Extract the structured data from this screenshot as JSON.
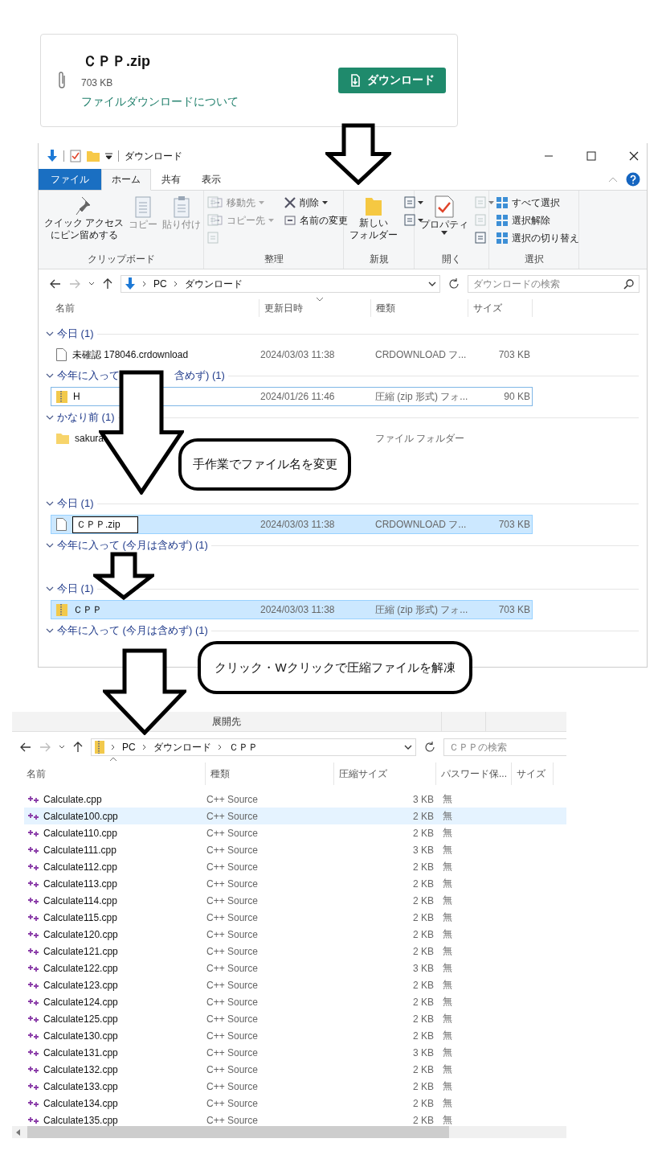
{
  "download_card": {
    "file_name": "ＣＰＰ.zip",
    "size": "703 KB",
    "link": "ファイルダウンロードについて",
    "button": "ダウンロード"
  },
  "explorer": {
    "title": "ダウンロード",
    "tabs": [
      {
        "label": "ファイル",
        "kind": "file",
        "selected": false
      },
      {
        "label": "ホーム",
        "kind": "tab",
        "selected": true
      },
      {
        "label": "共有",
        "kind": "tab",
        "selected": false
      },
      {
        "label": "表示",
        "kind": "tab",
        "selected": false
      }
    ],
    "ribbon": [
      {
        "label": "クリップボード",
        "items": [
          {
            "kind": "large",
            "lines": [
              "クイック アクセス",
              "にピン留めする"
            ],
            "disabled": false,
            "dropdown": false
          },
          {
            "kind": "large",
            "lines": [
              "コピー"
            ],
            "disabled": true,
            "dropdown": false
          },
          {
            "kind": "large",
            "lines": [
              "貼り付け"
            ],
            "disabled": true,
            "dropdown": false
          },
          {
            "kind": "icon",
            "disabled": true,
            "dropdown": false
          },
          {
            "kind": "icon",
            "disabled": true,
            "dropdown": false
          },
          {
            "kind": "icon",
            "disabled": true,
            "dropdown": false
          }
        ]
      },
      {
        "label": "整理",
        "items": [
          {
            "kind": "small",
            "label": "移動先",
            "disabled": true,
            "dropdown": true
          },
          {
            "kind": "small",
            "label": "コピー先",
            "disabled": true,
            "dropdown": true
          },
          {
            "kind": "small",
            "label": "削除",
            "disabled": false,
            "dropdown": true
          },
          {
            "kind": "small",
            "label": "名前の変更",
            "disabled": false,
            "dropdown": false
          }
        ]
      },
      {
        "label": "新規",
        "items": [
          {
            "kind": "large",
            "lines": [
              "新しい",
              "フォルダー"
            ],
            "disabled": false,
            "dropdown": false
          },
          {
            "kind": "icon",
            "disabled": false,
            "dropdown": true
          },
          {
            "kind": "icon",
            "disabled": false,
            "dropdown": true
          }
        ]
      },
      {
        "label": "開く",
        "items": [
          {
            "kind": "large",
            "lines": [
              "プロパティ"
            ],
            "disabled": false,
            "dropdown": true
          },
          {
            "kind": "icon",
            "disabled": true,
            "dropdown": true
          },
          {
            "kind": "icon",
            "disabled": true,
            "dropdown": false
          },
          {
            "kind": "icon",
            "disabled": false,
            "dropdown": false
          }
        ]
      },
      {
        "label": "選択",
        "items": [
          {
            "kind": "small",
            "label": "すべて選択",
            "disabled": false,
            "dropdown": false
          },
          {
            "kind": "small",
            "label": "選択解除",
            "disabled": false,
            "dropdown": false
          },
          {
            "kind": "small",
            "label": "選択の切り替え",
            "disabled": false,
            "dropdown": false
          }
        ]
      }
    ],
    "breadcrumbs": [
      "PC",
      "ダウンロード"
    ],
    "search_placeholder": "ダウンロードの検索",
    "columns": [
      "名前",
      "更新日時",
      "種類",
      "サイズ"
    ],
    "views": [
      {
        "groups": [
          {
            "label": "今日 (1)",
            "rows": [
              {
                "kind": "file",
                "name": "未確認 178046.crdownload",
                "date": "2024/03/03 11:38",
                "type": "CRDOWNLOAD フ...",
                "size": "703 KB",
                "selected": false,
                "focused": false,
                "editing": false
              }
            ]
          },
          {
            "label": "今年に入って",
            "label_after_gap": "含めず) (1)",
            "rows": [
              {
                "kind": "zip",
                "name": "H",
                "date": "2024/01/26 11:46",
                "type": "圧縮 (zip 形式) フォ...",
                "size": "90 KB",
                "selected": false,
                "focused": true,
                "editing": false
              }
            ]
          },
          {
            "label": "かなり前 (1)",
            "rows": [
              {
                "kind": "folder",
                "name": "sakura",
                "type": "ファイル フォルダー",
                "selected": false,
                "focused": false,
                "editing": false
              }
            ]
          }
        ]
      },
      {
        "groups": [
          {
            "label": "今日 (1)",
            "rows": [
              {
                "kind": "file",
                "name": "ＣＰＰ.zip",
                "date": "2024/03/03 11:38",
                "type": "CRDOWNLOAD フ...",
                "size": "703 KB",
                "selected": true,
                "focused": false,
                "editing": true
              }
            ]
          },
          {
            "label": "今年に入って (今月は含めず) (1)"
          }
        ]
      },
      {
        "groups": [
          {
            "label": "今日 (1)",
            "rows": [
              {
                "kind": "zip",
                "name": "ＣＰＰ",
                "date": "2024/03/03 11:38",
                "type": "圧縮 (zip 形式) フォ...",
                "size": "703 KB",
                "selected": true,
                "focused": false,
                "editing": false
              }
            ]
          },
          {
            "label": "今年に入って (今月は含めず) (1)"
          }
        ]
      }
    ]
  },
  "callouts": [
    "手作業でファイル名を変更",
    "クリック・Wクリックで圧縮ファイルを解凍"
  ],
  "extract_window": {
    "header": "展開先",
    "breadcrumbs": [
      "PC",
      "ダウンロード",
      "ＣＰＰ"
    ],
    "search_placeholder": "ＣＰＰの検索",
    "columns": [
      "名前",
      "種類",
      "圧縮サイズ",
      "パスワード保...",
      "サイズ"
    ],
    "rows": [
      {
        "name": "Calculate.cpp",
        "type": "C++ Source",
        "compressed": "3 KB",
        "password": "無",
        "selected": false
      },
      {
        "name": "Calculate100.cpp",
        "type": "C++ Source",
        "compressed": "2 KB",
        "password": "無",
        "selected": true
      },
      {
        "name": "Calculate110.cpp",
        "type": "C++ Source",
        "compressed": "2 KB",
        "password": "無",
        "selected": false
      },
      {
        "name": "Calculate111.cpp",
        "type": "C++ Source",
        "compressed": "3 KB",
        "password": "無",
        "selected": false
      },
      {
        "name": "Calculate112.cpp",
        "type": "C++ Source",
        "compressed": "2 KB",
        "password": "無",
        "selected": false
      },
      {
        "name": "Calculate113.cpp",
        "type": "C++ Source",
        "compressed": "2 KB",
        "password": "無",
        "selected": false
      },
      {
        "name": "Calculate114.cpp",
        "type": "C++ Source",
        "compressed": "2 KB",
        "password": "無",
        "selected": false
      },
      {
        "name": "Calculate115.cpp",
        "type": "C++ Source",
        "compressed": "2 KB",
        "password": "無",
        "selected": false
      },
      {
        "name": "Calculate120.cpp",
        "type": "C++ Source",
        "compressed": "2 KB",
        "password": "無",
        "selected": false
      },
      {
        "name": "Calculate121.cpp",
        "type": "C++ Source",
        "compressed": "2 KB",
        "password": "無",
        "selected": false
      },
      {
        "name": "Calculate122.cpp",
        "type": "C++ Source",
        "compressed": "3 KB",
        "password": "無",
        "selected": false
      },
      {
        "name": "Calculate123.cpp",
        "type": "C++ Source",
        "compressed": "2 KB",
        "password": "無",
        "selected": false
      },
      {
        "name": "Calculate124.cpp",
        "type": "C++ Source",
        "compressed": "2 KB",
        "password": "無",
        "selected": false
      },
      {
        "name": "Calculate125.cpp",
        "type": "C++ Source",
        "compressed": "2 KB",
        "password": "無",
        "selected": false
      },
      {
        "name": "Calculate130.cpp",
        "type": "C++ Source",
        "compressed": "2 KB",
        "password": "無",
        "selected": false
      },
      {
        "name": "Calculate131.cpp",
        "type": "C++ Source",
        "compressed": "3 KB",
        "password": "無",
        "selected": false
      },
      {
        "name": "Calculate132.cpp",
        "type": "C++ Source",
        "compressed": "2 KB",
        "password": "無",
        "selected": false
      },
      {
        "name": "Calculate133.cpp",
        "type": "C++ Source",
        "compressed": "2 KB",
        "password": "無",
        "selected": false
      },
      {
        "name": "Calculate134.cpp",
        "type": "C++ Source",
        "compressed": "2 KB",
        "password": "無",
        "selected": false
      },
      {
        "name": "Calculate135.cpp",
        "type": "C++ Source",
        "compressed": "2 KB",
        "password": "無",
        "selected": false
      }
    ]
  }
}
